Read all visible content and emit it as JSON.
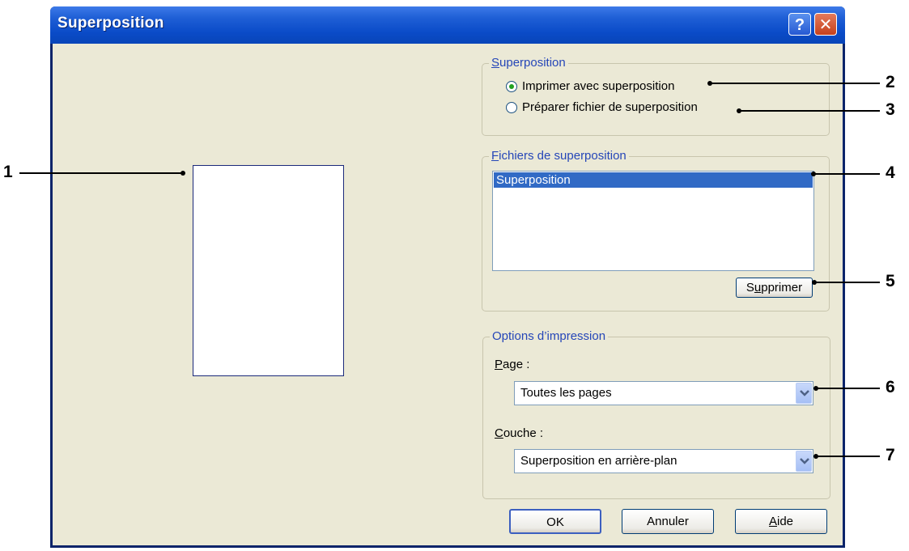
{
  "window": {
    "title": "Superposition",
    "help_label": "?",
    "close_label": "✕"
  },
  "superposition_group": {
    "legend": "Superposition",
    "legend_accel": "S",
    "legend_rest": "uperposition",
    "options": [
      {
        "label": "Imprimer avec superposition",
        "checked": true
      },
      {
        "label": "Préparer fichier de superposition",
        "checked": false
      }
    ]
  },
  "files_group": {
    "legend_accel": "F",
    "legend_rest": "ichiers de superposition",
    "items": [
      "Superposition"
    ],
    "delete_button_pre": "S",
    "delete_button_accel": "u",
    "delete_button_post": "pprimer"
  },
  "print_options": {
    "legend": "Options d’impression",
    "page_label_accel": "P",
    "page_label_rest": "age :",
    "page_value": "Toutes les pages",
    "layer_label_accel": "C",
    "layer_label_rest": "ouche :",
    "layer_value": "Superposition en arrière-plan"
  },
  "buttons": {
    "ok": "OK",
    "cancel": "Annuler",
    "help_accel": "A",
    "help_rest": "ide"
  },
  "callouts": [
    "1",
    "2",
    "3",
    "4",
    "5",
    "6",
    "7"
  ],
  "colors": {
    "title_bar": "#0a4bc8",
    "dialog_bg": "#ebe9d6",
    "selection": "#316ac5"
  }
}
